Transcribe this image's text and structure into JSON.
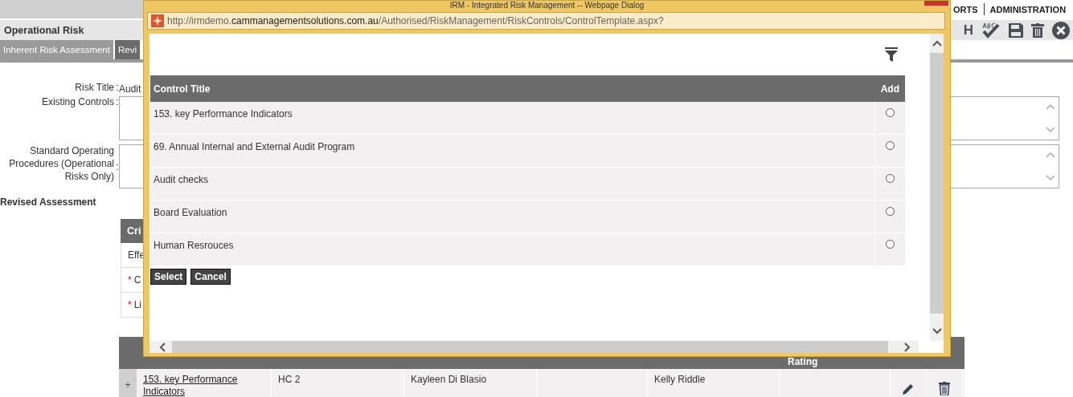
{
  "top_nav": {
    "items": [
      "ORTS",
      "ADMINISTRATION"
    ]
  },
  "toolbar": {
    "title": "Operational Risk",
    "h_label": "H"
  },
  "tabs": [
    {
      "label": "Inherent Risk Assessment",
      "selected": false
    },
    {
      "label": "Revi",
      "selected": true
    }
  ],
  "form": {
    "risk_title_label": "Risk Title",
    "risk_title_separator": ":",
    "risk_title_value": "Audit",
    "existing_controls_label": "Existing Controls",
    "existing_controls_separator": ":",
    "sop_label": "Standard Operating Procedures (Operational Risks Only)",
    "sop_separator": ":",
    "section_heading": "Revised Assessment"
  },
  "criteria_table": {
    "header": "Cri",
    "rows": [
      {
        "label": "Effe"
      },
      {
        "marker": "*",
        "label": "C"
      },
      {
        "marker": "*",
        "label": "Li"
      }
    ]
  },
  "controls_table": {
    "header_visible": "Rating",
    "rows": [
      {
        "expand": "+",
        "title": "153. key Performance Indicators",
        "code": "HC 2",
        "owner": "Kayleen Di Blasio",
        "column_4": "",
        "reviewer": "Kelly Riddle"
      }
    ]
  },
  "dialog": {
    "title": "IRM - Integrated Risk Management -- Webpage Dialog",
    "url_prefix": "http://irmdemo.",
    "url_domain": "cammanagementsolutions.com.au",
    "url_path": "/Authorised/RiskManagement/RiskControls/ControlTemplate.aspx?",
    "columns": [
      "Control Title",
      "Add"
    ],
    "rows": [
      {
        "title": "153. key Performance Indicators",
        "selected": false
      },
      {
        "title": "69. Annual Internal and External Audit Program",
        "selected": false
      },
      {
        "title": "Audit checks",
        "selected": false
      },
      {
        "title": "Board Evaluation",
        "selected": false
      },
      {
        "title": "Human Resrouces",
        "selected": false
      }
    ],
    "buttons": [
      "Select",
      "Cancel"
    ]
  }
}
